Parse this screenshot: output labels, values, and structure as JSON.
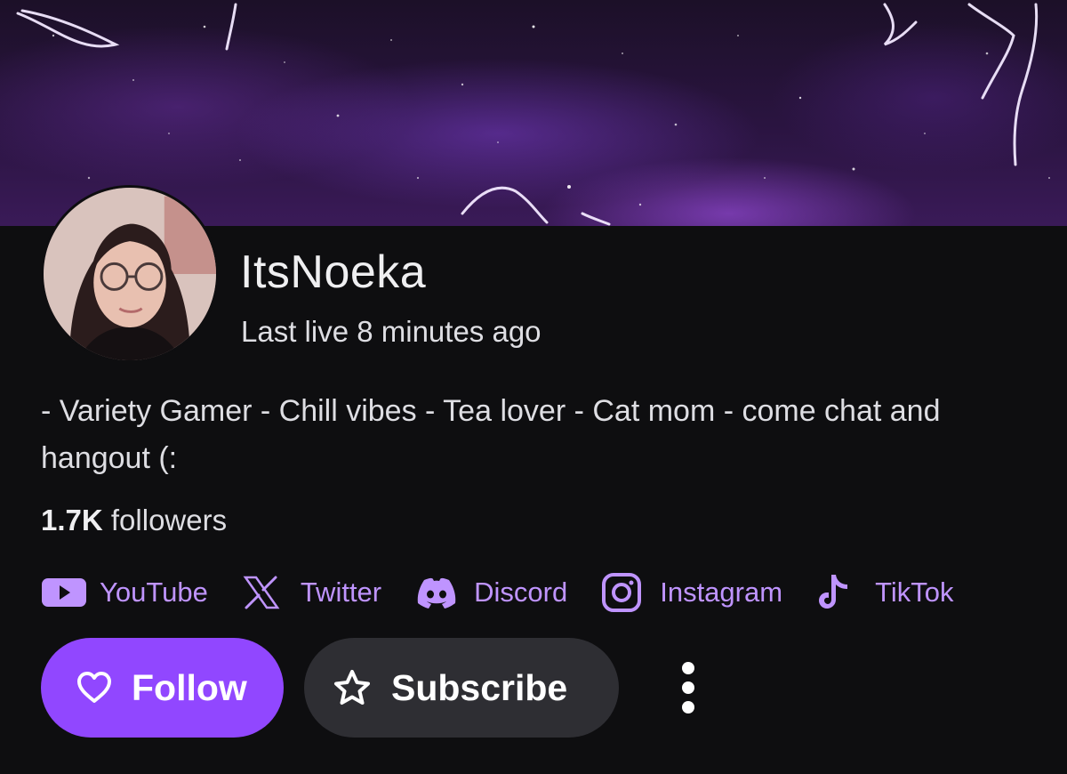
{
  "channel": {
    "name": "ItsNoeka",
    "last_live": "Last live 8 minutes ago",
    "bio": "- Variety Gamer - Chill vibes - Tea lover - Cat mom - come chat and hangout (:",
    "followers_count": "1.7K",
    "followers_label": "followers"
  },
  "socials": [
    {
      "label": "YouTube",
      "icon": "youtube-icon"
    },
    {
      "label": "Twitter",
      "icon": "x-twitter-icon"
    },
    {
      "label": "Discord",
      "icon": "discord-icon"
    },
    {
      "label": "Instagram",
      "icon": "instagram-icon"
    },
    {
      "label": "TikTok",
      "icon": "tiktok-icon"
    }
  ],
  "actions": {
    "follow_label": "Follow",
    "follow_icon": "heart-icon",
    "subscribe_label": "Subscribe",
    "subscribe_icon": "star-icon",
    "more_icon": "vertical-ellipsis-icon"
  },
  "colors": {
    "accent": "#9147ff",
    "link": "#bf94ff",
    "background": "#0e0e10",
    "secondary_button": "#2e2e33"
  }
}
